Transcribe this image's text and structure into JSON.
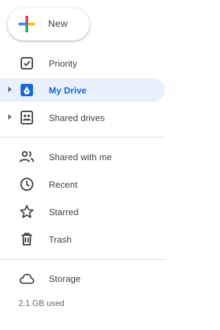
{
  "new_button": {
    "label": "New",
    "icon": "plus-icon"
  },
  "nav": {
    "priority": {
      "label": "Priority",
      "icon": "priority-check-icon"
    },
    "my_drive": {
      "label": "My Drive",
      "icon": "my-drive-icon",
      "active": true
    },
    "shared_drives": {
      "label": "Shared drives",
      "icon": "shared-drives-icon"
    },
    "shared_with_me": {
      "label": "Shared with me",
      "icon": "people-icon"
    },
    "recent": {
      "label": "Recent",
      "icon": "clock-icon"
    },
    "starred": {
      "label": "Starred",
      "icon": "star-icon"
    },
    "trash": {
      "label": "Trash",
      "icon": "trash-icon"
    },
    "storage": {
      "label": "Storage",
      "icon": "cloud-icon"
    }
  },
  "storage": {
    "used_text": "2.1 GB used"
  },
  "colors": {
    "active_bg": "#e8f0fe",
    "active_text": "#1967d2",
    "icon_gray": "#5f6368",
    "google_blue": "#4285f4",
    "google_red": "#ea4335",
    "google_yellow": "#fbbc04",
    "google_green": "#34a853"
  }
}
